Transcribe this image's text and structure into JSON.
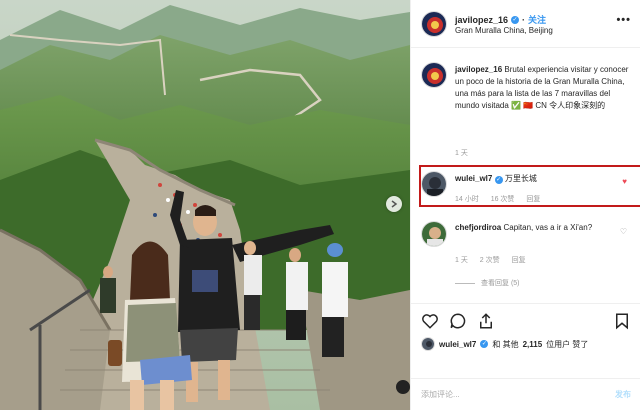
{
  "post": {
    "username": "javilopez_16",
    "follow_label": "关注",
    "location": "Gran Muralla China, Beijing",
    "more_label": "•••"
  },
  "caption": {
    "username": "javilopez_16",
    "text": "Brutal experiencia visitar y conocer un poco de la historia de la Gran Muralla China, una más para la lista de las 7 maravillas del mundo visitada ✅ 🇨🇳 CN 令人印象深刻的",
    "time": "1 天"
  },
  "comments": [
    {
      "username": "wulei_wl7",
      "text": "万里长城",
      "time": "14 小时",
      "likes": "16 次赞",
      "reply": "回复",
      "liked": true
    },
    {
      "username": "chefjordiroa",
      "text": "Capitan, vas a ir a Xi'an?",
      "time": "1 天",
      "likes": "2 次赞",
      "reply": "回复",
      "liked": false,
      "view_replies": "查看回复 (5)"
    }
  ],
  "likes_line": {
    "user": "wulei_wl7",
    "middle": "和 其他",
    "count": "2,115",
    "suffix": "位用户 赞了"
  },
  "add_comment": {
    "placeholder": "添加评论...",
    "post_label": "发布"
  },
  "colors": {
    "accent": "#3897f0",
    "highlight_box": "#c21a1a",
    "heart": "#ed4956"
  }
}
